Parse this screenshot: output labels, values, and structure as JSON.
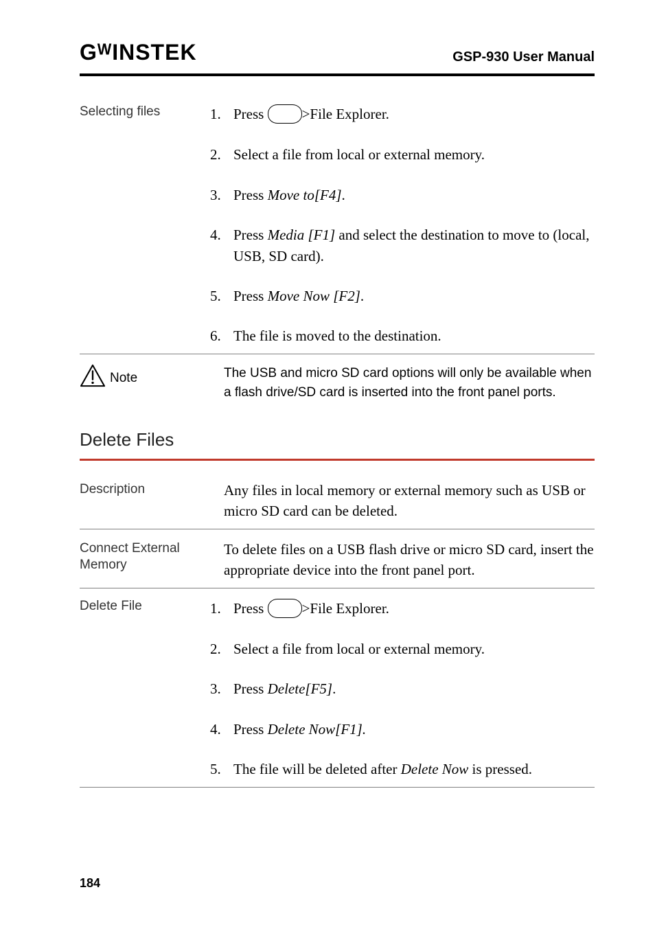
{
  "header": {
    "logo": "GᵂINSTEK",
    "title": "GSP-930 User Manual"
  },
  "selecting": {
    "label": "Selecting files",
    "steps": {
      "s1a": "Press ",
      "s1b": ">File Explorer.",
      "s2": "Select a file from local or external memory.",
      "s3a": "Press ",
      "s3b": "Move to[F4]",
      "s3c": ".",
      "s4a": "Press ",
      "s4b": "Media [F1]",
      "s4c": " and select the destination to move to (local, USB, SD card).",
      "s5a": "Press ",
      "s5b": "Move Now [F2]",
      "s5c": ".",
      "s6": "The file is moved to the destination."
    }
  },
  "note": {
    "label": "Note",
    "text": "The USB and micro SD card options will only be available when a flash drive/SD card is inserted into the front panel ports."
  },
  "delete": {
    "title": "Delete Files",
    "description": {
      "label": "Description",
      "text": "Any files in local memory or external memory such as USB or micro SD card can be deleted."
    },
    "connect": {
      "label": "Connect External Memory",
      "text": "To delete files on a USB flash drive or micro SD card, insert the appropriate device into the front panel port."
    },
    "deletefile": {
      "label": "Delete File",
      "steps": {
        "s1a": "Press ",
        "s1b": ">File Explorer.",
        "s2": "Select a file from local or external memory.",
        "s3a": "Press ",
        "s3b": "Delete[F5]",
        "s3c": ".",
        "s4a": "Press ",
        "s4b": "Delete Now[F1].",
        "s5a": "The file will be deleted after ",
        "s5b": "Delete Now",
        "s5c": " is pressed."
      }
    }
  },
  "page_number": "184"
}
